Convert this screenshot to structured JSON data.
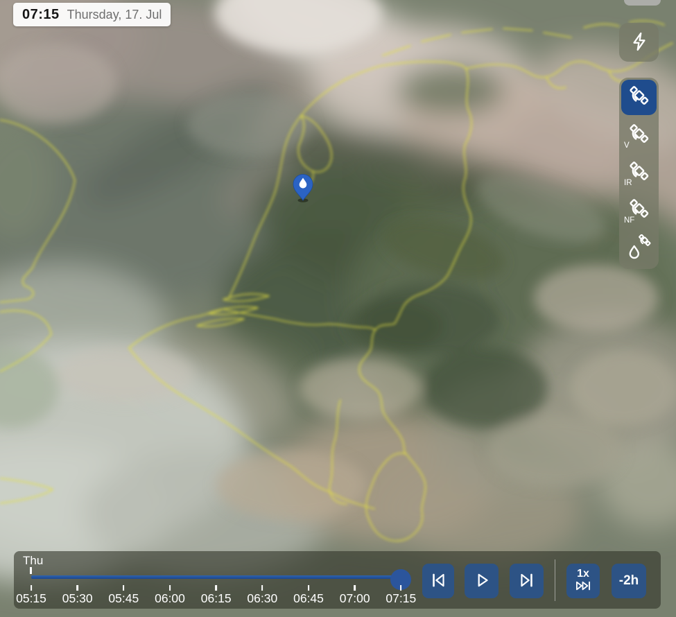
{
  "header": {
    "time": "07:15",
    "date": "Thursday, 17. Jul"
  },
  "toolbar": {
    "lightning_icon": "lightning-icon",
    "layers": [
      {
        "label": "",
        "icon": "satellite-icon",
        "selected": true
      },
      {
        "label": "V",
        "icon": "satellite-icon",
        "selected": false
      },
      {
        "label": "IR",
        "icon": "satellite-icon",
        "selected": false
      },
      {
        "label": "NF",
        "icon": "satellite-icon",
        "selected": false
      },
      {
        "label": "",
        "icon": "droplet-satellite-icon",
        "selected": false
      }
    ]
  },
  "timeline": {
    "day_label": "Thu",
    "ticks": [
      "05:15",
      "05:30",
      "05:45",
      "06:00",
      "06:15",
      "06:30",
      "06:45",
      "07:00",
      "07:15"
    ],
    "current_position": "07:15",
    "controls": {
      "speed_label": "1x",
      "offset_label": "-2h"
    }
  },
  "map": {
    "pin": "blue-location-pin"
  },
  "colors": {
    "accent_blue": "#2d5385",
    "selected_layer_blue": "#1f4c8d",
    "pin_blue": "#2b63c3",
    "border_yellow": "#e6e23f",
    "track_blue": "#23509a",
    "panel_olive": "rgba(119,122,104,0.78)",
    "bar_dark": "rgba(48,52,40,0.6)"
  }
}
